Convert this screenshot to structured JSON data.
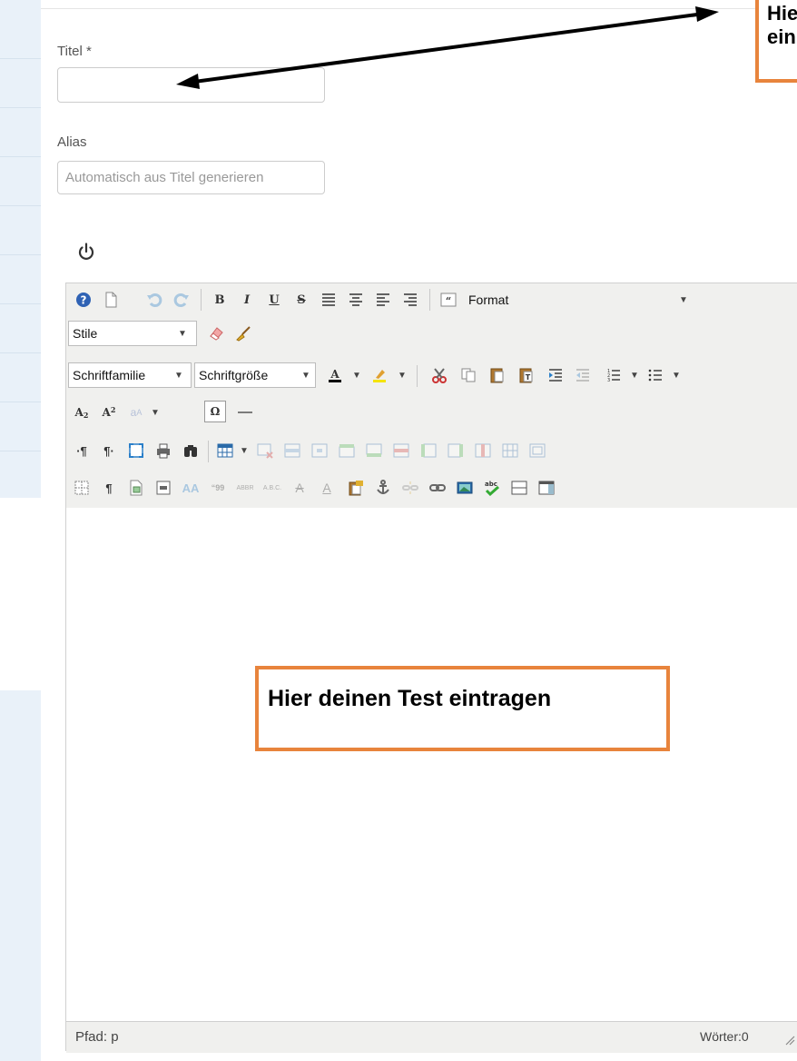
{
  "form": {
    "title_label": "Titel *",
    "title_value": "",
    "alias_label": "Alias",
    "alias_placeholder": "Automatisch aus Titel generieren"
  },
  "editor": {
    "format_label": "Format",
    "styles_label": "Stile",
    "font_family_label": "Schriftfamilie",
    "font_size_label": "Schriftgröße",
    "path_label": "Pfad: p",
    "word_count_label": "Wörter:0"
  },
  "callouts": {
    "top_right_line1": "Hie",
    "top_right_line2": "ein",
    "content": "Hier deinen Test eintragen"
  },
  "colors": {
    "callout_border": "#e8843c",
    "sidebar": "#e9f1f9",
    "toolbar": "#f0f0ee"
  }
}
